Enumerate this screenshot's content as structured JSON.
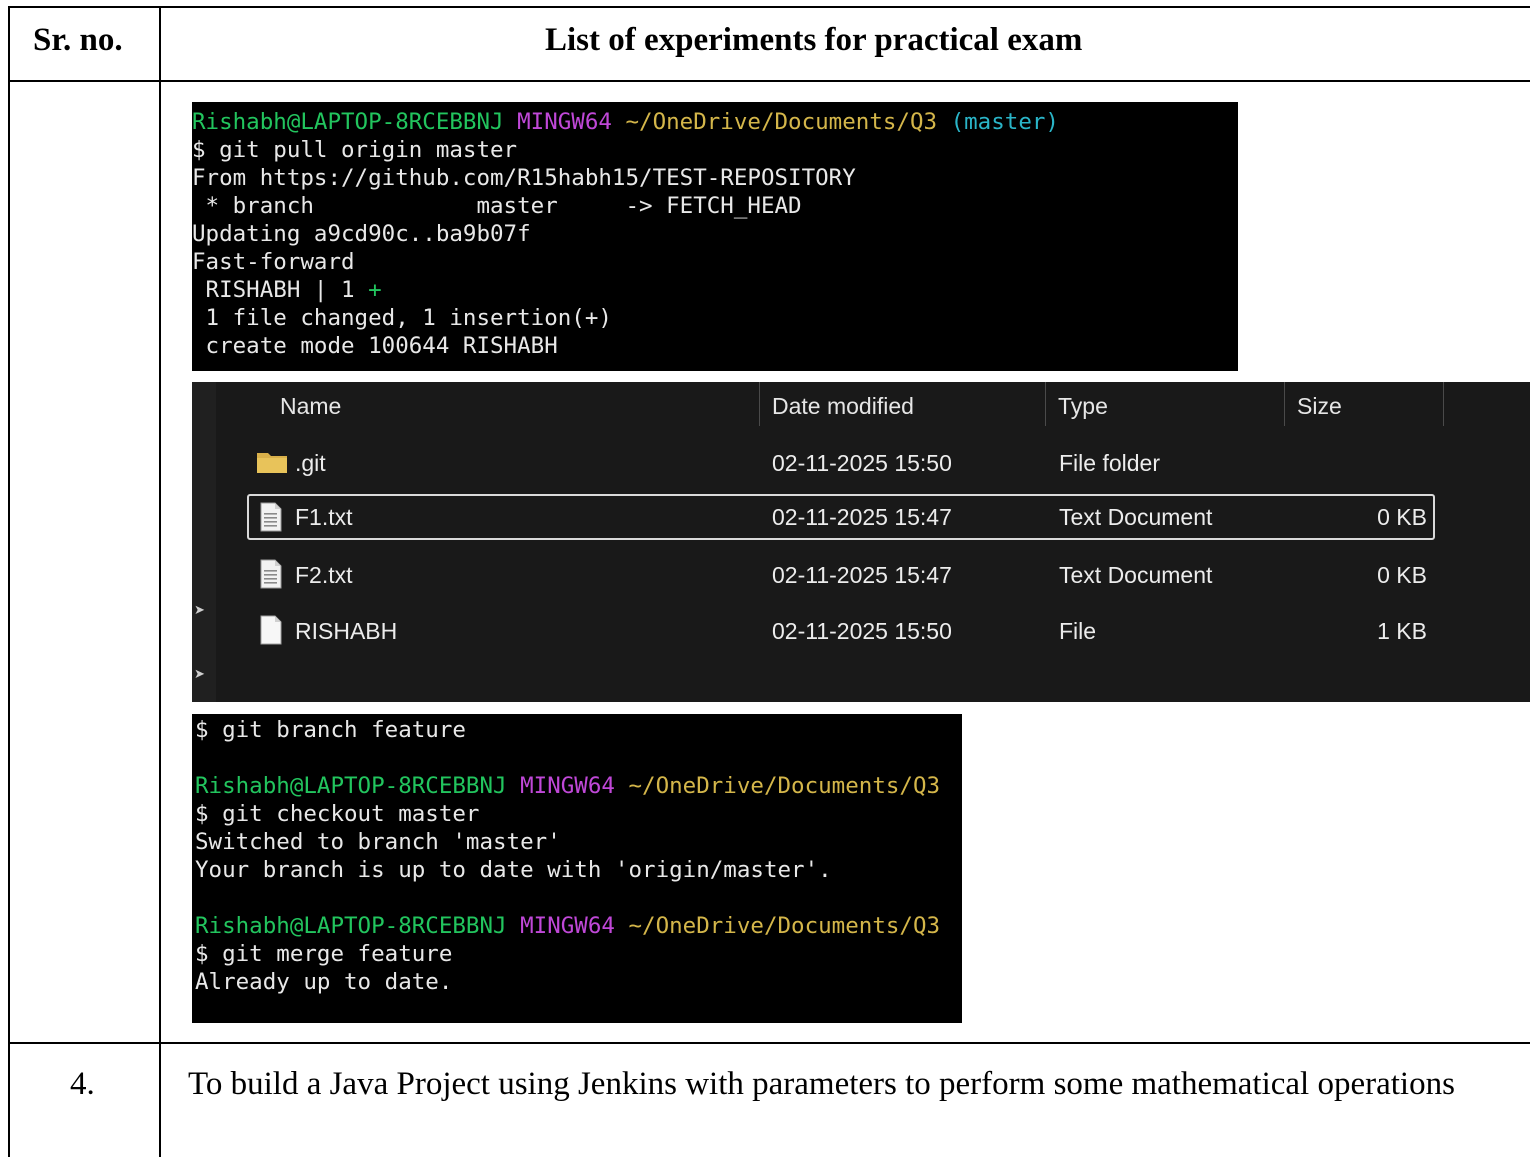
{
  "table": {
    "header": {
      "col1": "Sr. no.",
      "col2": "List of experiments for practical exam"
    },
    "row_4": {
      "number": "4.",
      "text": "To build a Java Project using Jenkins with parameters to perform some mathematical operations"
    }
  },
  "terminal1": {
    "prompt_user": "Rishabh@LAPTOP-8RCEBBNJ",
    "prompt_env": "MINGW64",
    "prompt_path": "~/OneDrive/Documents/Q3",
    "prompt_branch": "(master)",
    "lines": [
      "$ git pull origin master",
      "From https://github.com/R15habh15/TEST-REPOSITORY",
      " * branch            master     -> FETCH_HEAD",
      "Updating a9cd90c..ba9b07f",
      "Fast-forward",
      " RISHABH | 1 ",
      " 1 file changed, 1 insertion(+)",
      " create mode 100644 RISHABH"
    ],
    "plus": "+"
  },
  "explorer": {
    "columns": {
      "name": "Name",
      "date": "Date modified",
      "type": "Type",
      "size": "Size"
    },
    "files": [
      {
        "icon": "folder-icon",
        "name": ".git",
        "date": "02-11-2025 15:50",
        "type": "File folder",
        "size": ""
      },
      {
        "icon": "text-file-icon",
        "name": "F1.txt",
        "date": "02-11-2025 15:47",
        "type": "Text Document",
        "size": "0 KB"
      },
      {
        "icon": "text-file-icon",
        "name": "F2.txt",
        "date": "02-11-2025 15:47",
        "type": "Text Document",
        "size": "0 KB"
      },
      {
        "icon": "blank-file-icon",
        "name": "RISHABH",
        "date": "02-11-2025 15:50",
        "type": "File",
        "size": "1 KB"
      }
    ]
  },
  "terminal2": {
    "line1": "$ git branch feature",
    "prompt_user": "Rishabh@LAPTOP-8RCEBBNJ",
    "prompt_env": "MINGW64",
    "prompt_path": "~/OneDrive/Documents/Q3",
    "block1": [
      "$ git checkout master",
      "Switched to branch 'master'",
      "Your branch is up to date with 'origin/master'."
    ],
    "block2": [
      "$ git merge feature",
      "Already up to date."
    ]
  },
  "colors": {
    "prompt_user": "#22c55e",
    "prompt_env": "#c048d8",
    "prompt_path": "#d4b64a",
    "prompt_branch": "#2ab5c8",
    "explorer_bg": "#191919",
    "folder": "#d9b04a"
  }
}
